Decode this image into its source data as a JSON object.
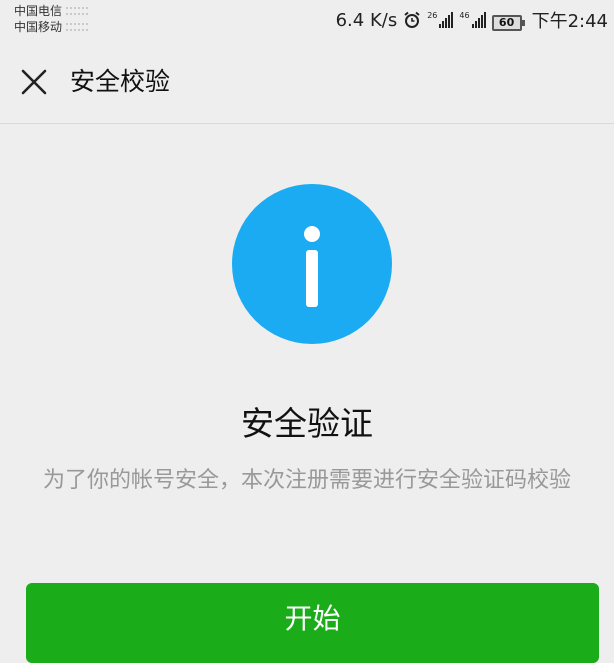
{
  "status_bar": {
    "carrier_1": "中国电信",
    "carrier_2": "中国移动",
    "net_speed": "6.4 K/s",
    "signal_1_label": "26",
    "signal_2_label": "46",
    "battery": "60",
    "time": "下午2:44"
  },
  "header": {
    "title": "安全校验"
  },
  "main": {
    "heading": "安全验证",
    "description": "为了你的帐号安全，本次注册需要进行安全验证码校验",
    "start_button_label": "开始"
  },
  "colors": {
    "info_blue": "#1aabf2",
    "primary_green": "#1aad19",
    "background": "#eeeeee",
    "description_gray": "#999999"
  }
}
